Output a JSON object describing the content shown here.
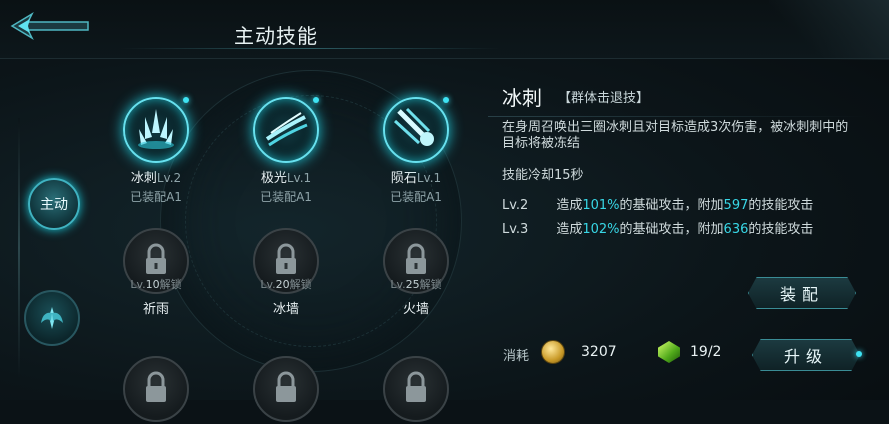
{
  "header": {
    "title": "主动技能"
  },
  "tabs": [
    {
      "label": "主动",
      "active": true
    },
    {
      "label": "",
      "active": false
    }
  ],
  "skills": [
    {
      "name": "冰刺",
      "level": "Lv.2",
      "status": "已装配A1",
      "state": "unlocked",
      "icon": "ice-spike-icon"
    },
    {
      "name": "极光",
      "level": "Lv.1",
      "status": "已装配A1",
      "state": "unlocked",
      "icon": "aurora-icon"
    },
    {
      "name": "陨石",
      "level": "Lv.1",
      "status": "已装配A1",
      "state": "unlocked",
      "icon": "meteor-icon"
    },
    {
      "name": "祈雨",
      "unlock_prefix": "Lv.",
      "unlock_level": "10",
      "unlock_suffix": "解锁",
      "state": "locked",
      "icon": "lock-icon"
    },
    {
      "name": "冰墙",
      "unlock_prefix": "Lv.",
      "unlock_level": "20",
      "unlock_suffix": "解锁",
      "state": "locked",
      "icon": "lock-icon"
    },
    {
      "name": "火墙",
      "unlock_prefix": "Lv.",
      "unlock_level": "25",
      "unlock_suffix": "解锁",
      "state": "locked",
      "icon": "lock-icon"
    }
  ],
  "detail": {
    "name": "冰刺",
    "tag": "【群体击退技】",
    "description": "在身周召唤出三圈冰刺且对目标造成3次伤害，被冰刺刺中的目标将被冻结",
    "cooldown": "技能冷却15秒",
    "levels": [
      {
        "lv": "Lv.2",
        "pre": "造成",
        "pct": "101%",
        "mid": "的基础攻击，附加",
        "bonus": "597",
        "post": "的技能攻击"
      },
      {
        "lv": "Lv.3",
        "pre": "造成",
        "pct": "102%",
        "mid": "的基础攻击，附加",
        "bonus": "636",
        "post": "的技能攻击"
      }
    ]
  },
  "actions": {
    "equip_label": "装配",
    "upgrade_label": "升级"
  },
  "cost": {
    "label": "消耗",
    "gold": "3207",
    "gem": "19/2"
  },
  "colors": {
    "accent": "#38d7e6",
    "text": "#d9e6e8",
    "bg": "#0b1216"
  }
}
